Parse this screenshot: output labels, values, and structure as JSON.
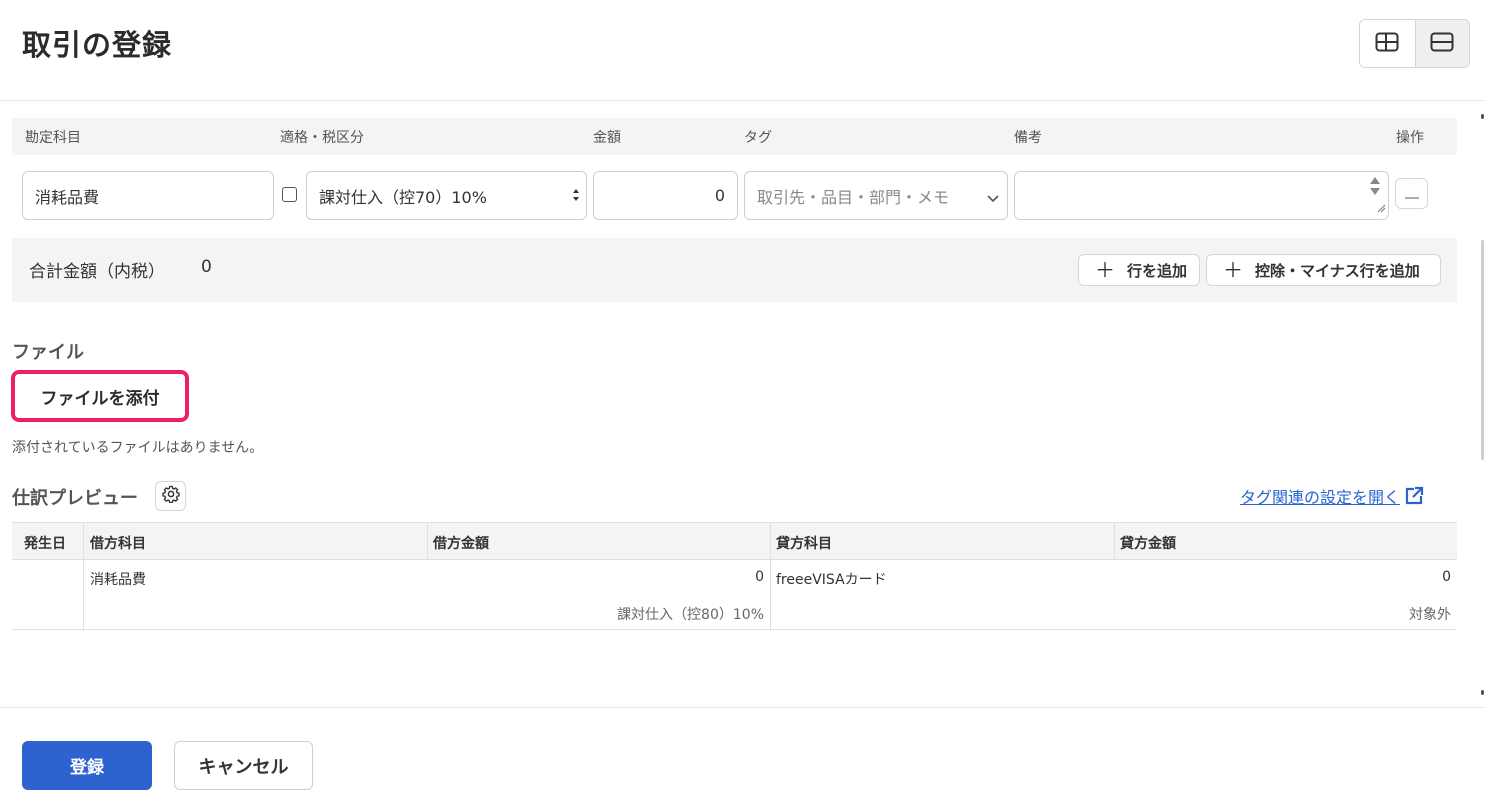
{
  "page": {
    "title": "取引の登録"
  },
  "layout_toggle": {
    "split_icon": "split-layout-icon",
    "stacked_icon": "stacked-layout-icon"
  },
  "columns": {
    "account": "勘定科目",
    "tax": "適格・税区分",
    "amount": "金額",
    "tag": "タグ",
    "note": "備考",
    "action": "操作"
  },
  "row": {
    "account_value": "消耗品費",
    "tax_value": "課対仕入（控70）10%",
    "amount_value": "0",
    "tag_placeholder": "取引先・品目・部門・メモ",
    "note_value": ""
  },
  "totals": {
    "label": "合計金額（内税）",
    "value": "0",
    "add_row_label": "行を追加",
    "add_deduction_label": "控除・マイナス行を追加"
  },
  "files": {
    "title": "ファイル",
    "attach_label": "ファイルを添付",
    "empty_text": "添付されているファイルはありません。"
  },
  "preview": {
    "title": "仕訳プレビュー",
    "tag_link": "タグ関連の設定を開く",
    "headers": [
      "発生日",
      "借方科目",
      "借方金額",
      "貸方科目",
      "貸方金額"
    ],
    "rows": [
      {
        "date": "",
        "debit_account": "消耗品費",
        "debit_amount": "0",
        "debit_tax": "課対仕入（控80）10%",
        "credit_account": "freeeVISAカード",
        "credit_amount": "0",
        "credit_tax": "対象外"
      }
    ]
  },
  "footer": {
    "submit_label": "登録",
    "cancel_label": "キャンセル"
  },
  "colors": {
    "primary": "#2e62ce",
    "highlight": "#ee1e6a",
    "link": "#2864d0"
  }
}
